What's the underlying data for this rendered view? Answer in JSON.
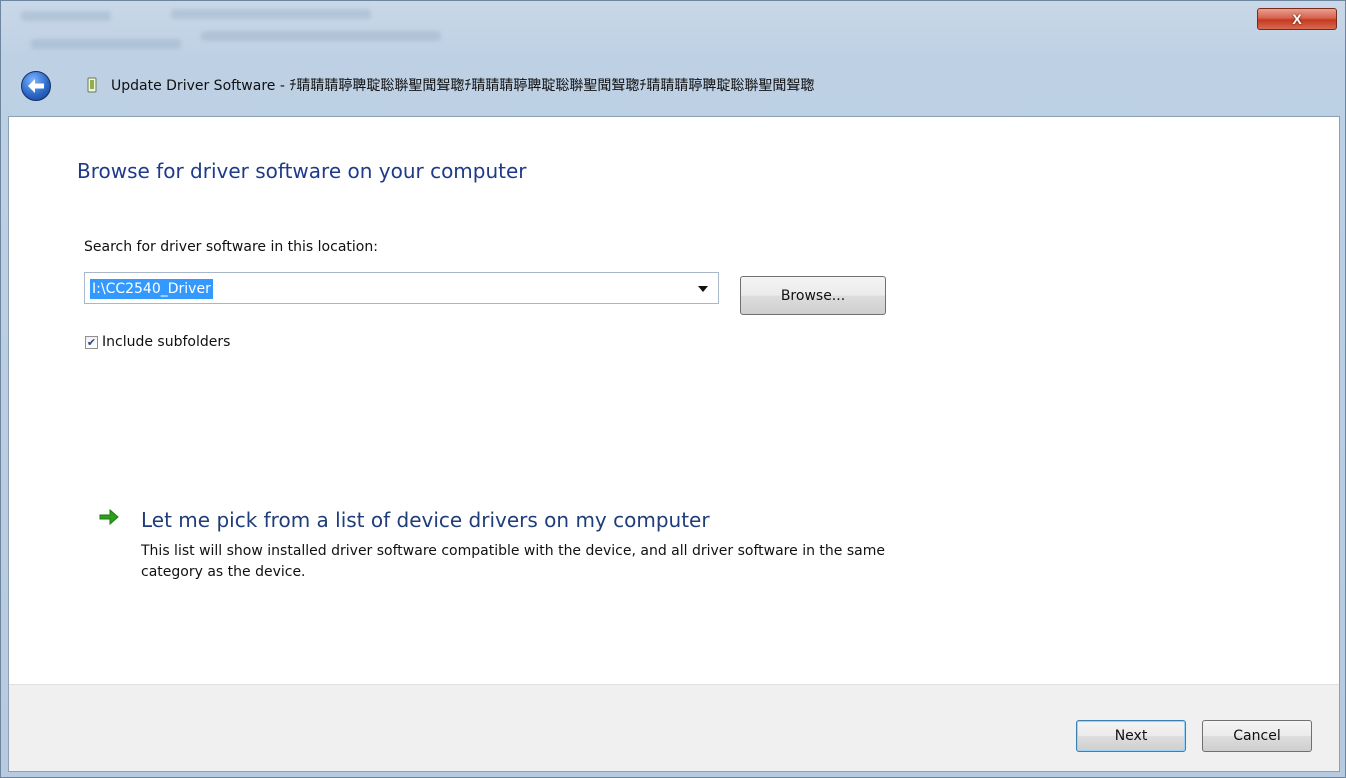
{
  "window": {
    "title": "Update Driver Software - ﻿ﾁ聙聙聙聤聛聢聡聨聖聞聟聦ﾁ聙聙聙聤聛聢聡聨聖聞聟聦ﾁ聙聙聙聤聛聢聡聨聖聞聟聦",
    "title_display": "Update Driver Software - ﻿ﾁ聙聙聙聤聛聢聡聨聖聞聟聦",
    "close_label": "X"
  },
  "main": {
    "heading": "Browse for driver software on your computer",
    "search_label": "Search for driver software in this location:",
    "path_value": "I:\\CC2540_Driver",
    "browse_label": "Browse...",
    "include_subfolders_label": "Include subfolders",
    "include_subfolders_checked": true,
    "pick_link": "Let me pick from a list of device drivers on my computer",
    "pick_description": "This list will show installed driver software compatible with the device, and all driver software in the same category as the device."
  },
  "footer": {
    "next_label": "Next",
    "cancel_label": "Cancel"
  },
  "icons": {
    "back": "back-arrow-icon",
    "device": "device-icon",
    "pick": "green-arrow-icon",
    "checkbox": "checkmark-icon"
  },
  "colors": {
    "heading": "#1e3a8a",
    "link": "#1f3d7a",
    "selection": "#3399ff",
    "close": "#c53a22",
    "arrow_green": "#2ca01c"
  }
}
